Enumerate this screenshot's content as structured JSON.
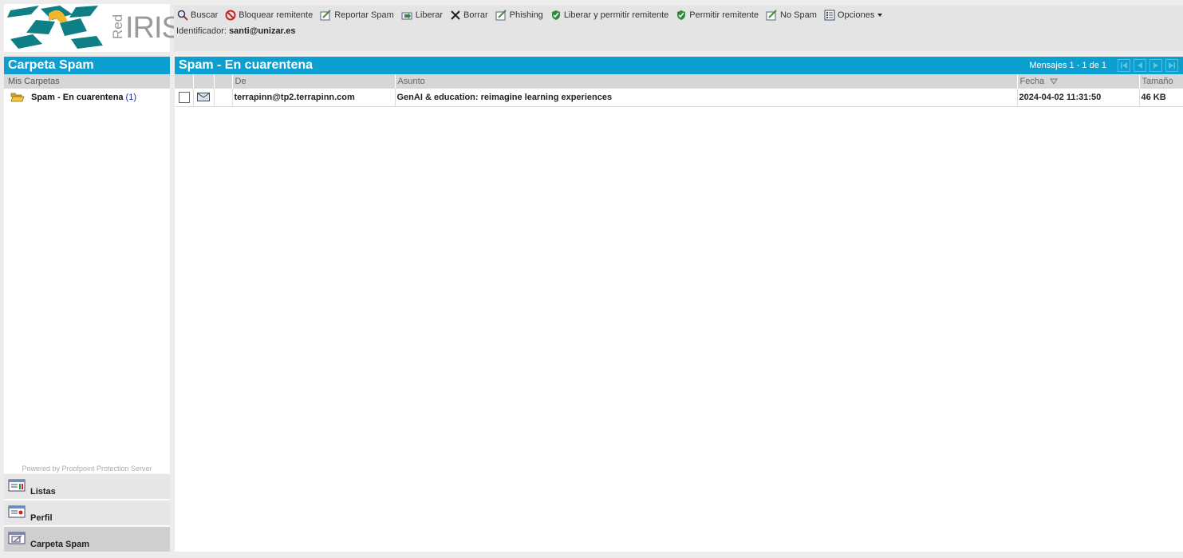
{
  "logo": {
    "text_red": "Red",
    "text_iris": "IRIS"
  },
  "toolbar": {
    "buttons": [
      {
        "label": "Buscar",
        "icon": "magnifier-icon"
      },
      {
        "label": "Bloquear remitente",
        "icon": "block-icon"
      },
      {
        "label": "Reportar Spam",
        "icon": "report-icon"
      },
      {
        "label": "Liberar",
        "icon": "release-icon"
      },
      {
        "label": "Borrar",
        "icon": "delete-x-icon"
      },
      {
        "label": "Phishing",
        "icon": "report-icon"
      },
      {
        "label": "Liberar y permitir remitente",
        "icon": "shield-check-icon"
      },
      {
        "label": "Permitir remitente",
        "icon": "shield-check-icon"
      },
      {
        "label": "No Spam",
        "icon": "report-icon"
      },
      {
        "label": "Opciones",
        "icon": "options-list-icon"
      }
    ]
  },
  "identity": {
    "label": "Identificador:",
    "value": "santi@unizar.es"
  },
  "sidebar": {
    "title": "Carpeta Spam",
    "subtitle": "Mis Carpetas",
    "folder": {
      "label": "Spam - En cuarentena",
      "count": "(1)"
    },
    "powered": "Powered by Proofpoint Protection Server",
    "nav": [
      {
        "label": "Listas"
      },
      {
        "label": "Perfil"
      },
      {
        "label": "Carpeta Spam"
      }
    ]
  },
  "main": {
    "title": "Spam - En cuarentena",
    "messages_range": "Mensajes 1 - 1 de 1",
    "columns": {
      "from": "De",
      "subject": "Asunto",
      "date": "Fecha",
      "size": "Tamaño"
    },
    "rows": [
      {
        "from": "terrapinn@tp2.terrapinn.com",
        "subject": "GenAI & education: reimagine learning experiences",
        "date": "2024-04-02 11:31:50",
        "size": "46 KB"
      }
    ]
  },
  "colors": {
    "accent": "#0c9fcf",
    "logo_teal": "#0f7f86",
    "logo_yellow": "#f0b62c"
  }
}
